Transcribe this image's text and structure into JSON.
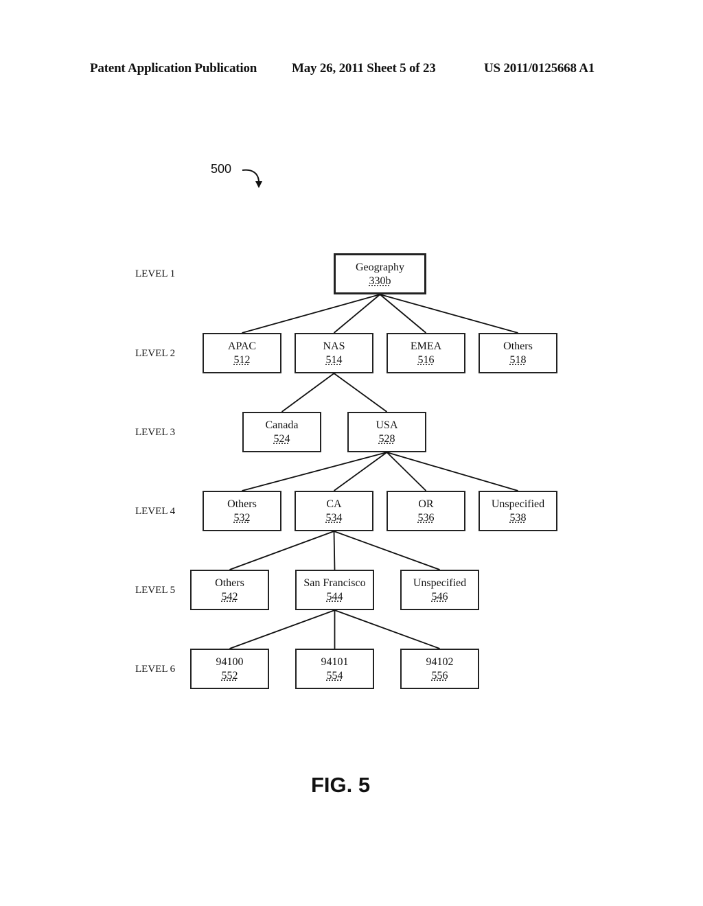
{
  "header": {
    "publication": "Patent Application Publication",
    "date_sheet": "May 26, 2011  Sheet 5 of 23",
    "patent_number": "US 2011/0125668 A1"
  },
  "figure": {
    "reference_number": "500",
    "caption": "FIG. 5"
  },
  "levels": [
    "LEVEL 1",
    "LEVEL 2",
    "LEVEL 3",
    "LEVEL 4",
    "LEVEL 5",
    "LEVEL 6"
  ],
  "nodes": {
    "geography": {
      "label": "Geography",
      "ref": "330b"
    },
    "apac": {
      "label": "APAC",
      "ref": "512"
    },
    "nas": {
      "label": "NAS",
      "ref": "514"
    },
    "emea": {
      "label": "EMEA",
      "ref": "516"
    },
    "others_l2": {
      "label": "Others",
      "ref": "518"
    },
    "canada": {
      "label": "Canada",
      "ref": "524"
    },
    "usa": {
      "label": "USA",
      "ref": "528"
    },
    "others_l4": {
      "label": "Others",
      "ref": "532"
    },
    "ca": {
      "label": "CA",
      "ref": "534"
    },
    "or": {
      "label": "OR",
      "ref": "536"
    },
    "unspecified_l4": {
      "label": "Unspecified",
      "ref": "538"
    },
    "others_l5": {
      "label": "Others",
      "ref": "542"
    },
    "san_francisco": {
      "label": "San Francisco",
      "ref": "544"
    },
    "unspecified_l5": {
      "label": "Unspecified",
      "ref": "546"
    },
    "zip_94100": {
      "label": "94100",
      "ref": "552"
    },
    "zip_94101": {
      "label": "94101",
      "ref": "554"
    },
    "zip_94102": {
      "label": "94102",
      "ref": "556"
    }
  },
  "edges": [
    [
      "geography",
      "apac"
    ],
    [
      "geography",
      "nas"
    ],
    [
      "geography",
      "emea"
    ],
    [
      "geography",
      "others_l2"
    ],
    [
      "nas",
      "canada"
    ],
    [
      "nas",
      "usa"
    ],
    [
      "usa",
      "others_l4"
    ],
    [
      "usa",
      "ca"
    ],
    [
      "usa",
      "or"
    ],
    [
      "usa",
      "unspecified_l4"
    ],
    [
      "ca",
      "others_l5"
    ],
    [
      "ca",
      "san_francisco"
    ],
    [
      "ca",
      "unspecified_l5"
    ],
    [
      "san_francisco",
      "zip_94100"
    ],
    [
      "san_francisco",
      "zip_94101"
    ],
    [
      "san_francisco",
      "zip_94102"
    ]
  ]
}
